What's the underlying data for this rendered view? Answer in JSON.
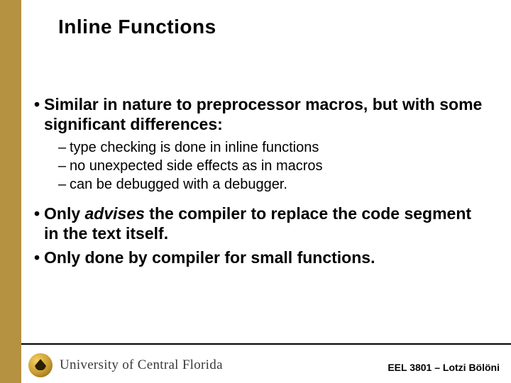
{
  "title": "Inline Functions",
  "bullets": {
    "b0": {
      "text": "Similar in nature to preprocessor macros, but with some significant differences:"
    },
    "sub": {
      "s0": "type checking is done in inline functions",
      "s1": "no unexpected side effects as in macros",
      "s2": "can be debugged with a debugger."
    },
    "b1": {
      "before": "Only ",
      "em": "advises",
      "after": " the compiler to replace the code segment in the text itself."
    },
    "b2": {
      "text": "Only done by compiler for small functions."
    }
  },
  "footer": {
    "university": "University of Central Florida",
    "course": "EEL 3801 – Lotzi Bölöni"
  }
}
